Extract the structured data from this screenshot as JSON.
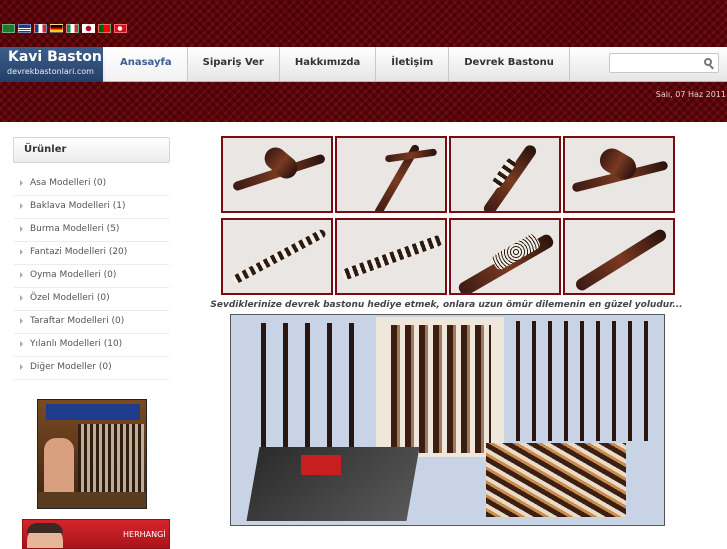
{
  "site": {
    "logo_title": "Kavi Baston",
    "logo_subtitle": "devrekbastonlari.com"
  },
  "languages": [
    {
      "name": "arabic",
      "icon": "flag-saudi-icon"
    },
    {
      "name": "english",
      "icon": "flag-uk-icon"
    },
    {
      "name": "french",
      "icon": "flag-france-icon"
    },
    {
      "name": "german",
      "icon": "flag-germany-icon"
    },
    {
      "name": "italian",
      "icon": "flag-italy-icon"
    },
    {
      "name": "japanese",
      "icon": "flag-japan-icon"
    },
    {
      "name": "portuguese",
      "icon": "flag-portugal-icon"
    },
    {
      "name": "turkish",
      "icon": "flag-turkey-icon"
    }
  ],
  "nav": {
    "items": [
      {
        "label": "Anasayfa",
        "active": true
      },
      {
        "label": "Sipariş Ver"
      },
      {
        "label": "Hakkımızda"
      },
      {
        "label": "İletişim"
      },
      {
        "label": "Devrek Bastonu"
      }
    ]
  },
  "search": {
    "placeholder": "",
    "value": ""
  },
  "date": "Salı, 07 Haz 2011",
  "sidebar": {
    "heading": "Ürünler",
    "categories": [
      "Asa Modelleri (0)",
      "Baklava Modelleri (1)",
      "Burma Modelleri (5)",
      "Fantazi Modelleri (20)",
      "Oyma Modelleri (0)",
      "Özel Modelleri (0)",
      "Taraftar Modelleri (0)",
      "Yılanlı Modelleri (10)",
      "Diğer Modeller (0)"
    ],
    "ad_banner_text": "HERHANGİ"
  },
  "main": {
    "tagline": "Sevdiklerinize devrek bastonu hediye etmek, onlara uzun ömür dilemenin en güzel yoludur...",
    "gallery_count": 8
  },
  "colors": {
    "brand_red": "#5a0409",
    "logo_blue": "#2c4a75",
    "active_nav": "#3a5f8f"
  }
}
